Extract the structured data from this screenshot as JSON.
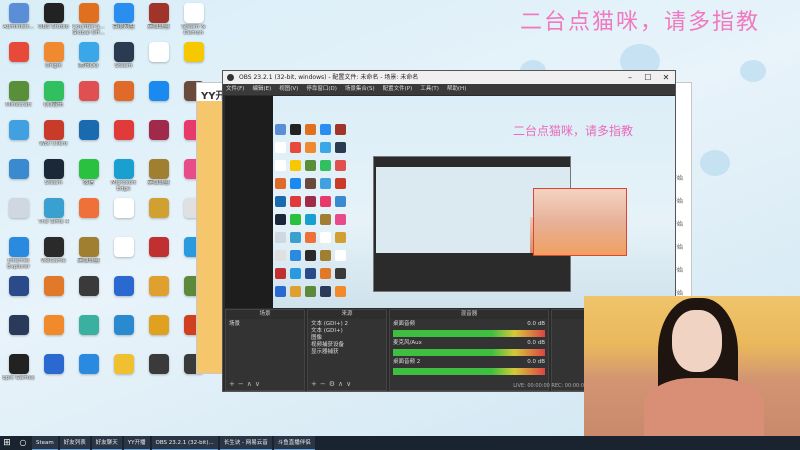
{
  "wallpaper": {
    "caption": "二台点猫咪，请多指教"
  },
  "desktop_icons": [
    {
      "label": "Administr...",
      "color": "#5a8fd8"
    },
    {
      "label": "OBS Studio",
      "color": "#222222"
    },
    {
      "label": "Counter-S... Global Off...",
      "color": "#e07020"
    },
    {
      "label": "百度网盘",
      "color": "#2a8ef0"
    },
    {
      "label": "英雄联盟",
      "color": "#a0332a"
    },
    {
      "label": "Steam & Demon",
      "color": "#ffffff"
    },
    {
      "label": "",
      "color": "#e84a3a"
    },
    {
      "label": "Origin",
      "color": "#f08a30"
    },
    {
      "label": "腾讯QQ",
      "color": "#3aa7e8"
    },
    {
      "label": "Steam",
      "color": "#2a3a50"
    },
    {
      "label": "",
      "color": "#ffffff"
    },
    {
      "label": "",
      "color": "#f5c800"
    },
    {
      "label": "Minecraft",
      "color": "#5a8f3a"
    },
    {
      "label": "QQ音乐",
      "color": "#30c060"
    },
    {
      "label": "",
      "color": "#e05050"
    },
    {
      "label": "",
      "color": "#e06a2a"
    },
    {
      "label": "",
      "color": "#1a8af0"
    },
    {
      "label": "",
      "color": "#6a4a3a"
    },
    {
      "label": "",
      "color": "#40a0e0"
    },
    {
      "label": "Wot Client",
      "color": "#c83a2a"
    },
    {
      "label": "",
      "color": "#1a6ab0"
    },
    {
      "label": "",
      "color": "#e03a3a"
    },
    {
      "label": "",
      "color": "#a02a4a"
    },
    {
      "label": "",
      "color": "#e83a6a"
    },
    {
      "label": "",
      "color": "#3a8ad0"
    },
    {
      "label": "Steam",
      "color": "#1b2838"
    },
    {
      "label": "微信",
      "color": "#2ac040"
    },
    {
      "label": "Microsoft Edge",
      "color": "#1aa0d0"
    },
    {
      "label": "英雄联盟",
      "color": "#a08030"
    },
    {
      "label": "",
      "color": "#e84a8a"
    },
    {
      "label": "",
      "color": "#cfd8e0"
    },
    {
      "label": "The Sims 4",
      "color": "#3aa0d0"
    },
    {
      "label": "",
      "color": "#f0703a"
    },
    {
      "label": "",
      "color": "#ffffff"
    },
    {
      "label": "",
      "color": "#d0a030"
    },
    {
      "label": "",
      "color": "#e0e0e0"
    },
    {
      "label": "Internet Explorer",
      "color": "#2a8ae0"
    },
    {
      "label": "WeGame",
      "color": "#2a2a2a"
    },
    {
      "label": "英雄联盟",
      "color": "#a08030"
    },
    {
      "label": "",
      "color": "#ffffff"
    },
    {
      "label": "",
      "color": "#c03030"
    },
    {
      "label": "",
      "color": "#2a9ae0"
    },
    {
      "label": "",
      "color": "#2a4a8a"
    },
    {
      "label": "",
      "color": "#e07a2a"
    },
    {
      "label": "",
      "color": "#3a3a3a"
    },
    {
      "label": "",
      "color": "#2a6ad0"
    },
    {
      "label": "",
      "color": "#e0a030"
    },
    {
      "label": "",
      "color": "#5a8a3a"
    },
    {
      "label": "",
      "color": "#2a3a5a"
    },
    {
      "label": "",
      "color": "#f08a2a"
    },
    {
      "label": "",
      "color": "#3ab0a0"
    },
    {
      "label": "",
      "color": "#2a8ad0"
    },
    {
      "label": "",
      "color": "#e0a020"
    },
    {
      "label": "",
      "color": "#d04020"
    },
    {
      "label": "Epic Games",
      "color": "#222222"
    },
    {
      "label": "",
      "color": "#2a6ad0"
    },
    {
      "label": "",
      "color": "#2a8ae0"
    },
    {
      "label": "",
      "color": "#f0c030"
    },
    {
      "label": "",
      "color": "#3a3a3a"
    },
    {
      "label": "",
      "color": "#3a3a3a"
    }
  ],
  "yy_window": {
    "logo": "YY开",
    "side_items": [
      "开始",
      "开始",
      "开始",
      "开始",
      "开始",
      "开始"
    ]
  },
  "obs": {
    "title": "OBS 23.2.1 (32-bit, windows) - 配置文件: 未命名 - 场景: 未命名",
    "menu": [
      "文件(F)",
      "编辑(E)",
      "视图(V)",
      "停靠窗口(D)",
      "场景集合(S)",
      "配置文件(P)",
      "工具(T)",
      "帮助(H)"
    ],
    "preview_caption": "二台点猫咪，请多指教",
    "docks": {
      "scenes": {
        "title": "场景",
        "items": [
          "场景"
        ]
      },
      "sources": {
        "title": "来源",
        "items": [
          "文本 (GDI+) 2",
          "文本 (GDI+)",
          "图像",
          "视频捕获设备",
          "显示器捕获"
        ]
      },
      "mixer": {
        "title": "混音器",
        "tracks": [
          {
            "name": "桌面音频",
            "db": "0.0 dB"
          },
          {
            "name": "麦克风/Aux",
            "db": "0.0 dB"
          },
          {
            "name": "桌面音频 2",
            "db": "0.0 dB"
          }
        ]
      },
      "controls": {
        "title": "控件"
      }
    },
    "status": "LIVE: 00:00:00    REC: 00:00:00    CPU: 2.0%"
  },
  "taskbar": {
    "items": [
      "Steam",
      "好友列表",
      "好友聊天",
      "YY开播",
      "OBS 23.2.1 (32-bit)...",
      "长生诀 - 网易云音",
      "斗鱼直播伴侣"
    ]
  }
}
